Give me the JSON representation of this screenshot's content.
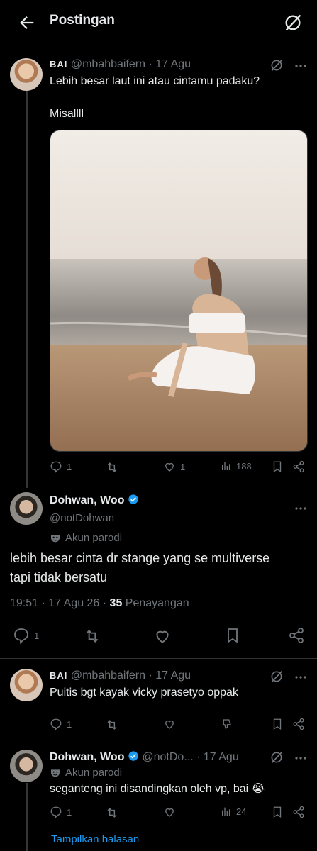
{
  "header": {
    "title": "Postingan"
  },
  "post1": {
    "display_name": "BAI",
    "handle_time": "@mbahbaifern · 17 Agu",
    "text_line1": "Lebih besar laut ini atau cintamu padaku?",
    "text_line2": "Misallll",
    "replies": "1",
    "likes": "1",
    "views": "188"
  },
  "main": {
    "display_name": "Dohwan, Woo",
    "handle": "@notDohwan",
    "parody_label": "Akun parodi",
    "text_line1": "lebih besar cinta dr stange yang se multiverse",
    "text_line2": "tapi tidak bersatu",
    "time_date": "19:51 · 17 Agu 26 · ",
    "views_count": "35",
    "views_label": " Penayangan",
    "replies": "1"
  },
  "reply1": {
    "display_name": "BAI",
    "handle_time": "@mbahbaifern · 17 Agu",
    "text": "Puitis bgt kayak vicky prasetyo oppak",
    "replies": "1"
  },
  "reply2": {
    "display_name": "Dohwan, Woo",
    "handle": "@notDo...",
    "time": "· 17 Agu",
    "parody_label": "Akun parodi",
    "text": "seganteng ini disandingkan oleh vp, bai 😭",
    "replies": "1",
    "views": "24"
  },
  "show_replies": "Tampilkan balasan",
  "colors": {
    "accent": "#1d9bf0",
    "muted": "#71767b",
    "text": "#e7e9ea",
    "bg": "#000000"
  }
}
